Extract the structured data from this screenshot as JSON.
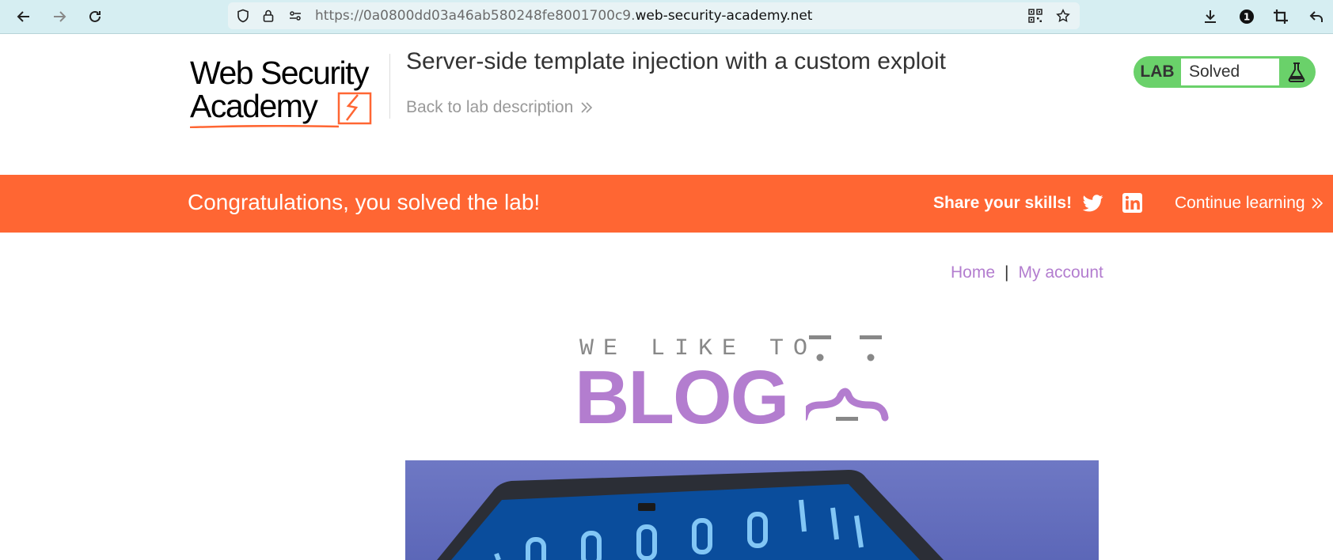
{
  "browser": {
    "url_prefix": "https://0a0800dd03a46ab580248fe8001700c9.",
    "url_domain": "web-security-academy.net",
    "notification_count": "1"
  },
  "header": {
    "logo_line1": "Web Security",
    "logo_line2": "Academy",
    "lab_title": "Server-side template injection with a custom exploit",
    "back_link": "Back to lab description",
    "lab_badge_label": "LAB",
    "lab_status": "Solved"
  },
  "banner": {
    "message": "Congratulations, you solved the lab!",
    "share_label": "Share your skills!",
    "continue_label": "Continue learning"
  },
  "blog": {
    "nav": {
      "home": "Home",
      "separator": "|",
      "my_account": "My account"
    },
    "header_small": "WE LIKE TO",
    "header_big": "BLOG"
  },
  "colors": {
    "banner": "#ff6633",
    "lab_solved": "#6ad16a",
    "blog_accent": "#b37dcf",
    "browser_bar": "#d6eef2"
  }
}
